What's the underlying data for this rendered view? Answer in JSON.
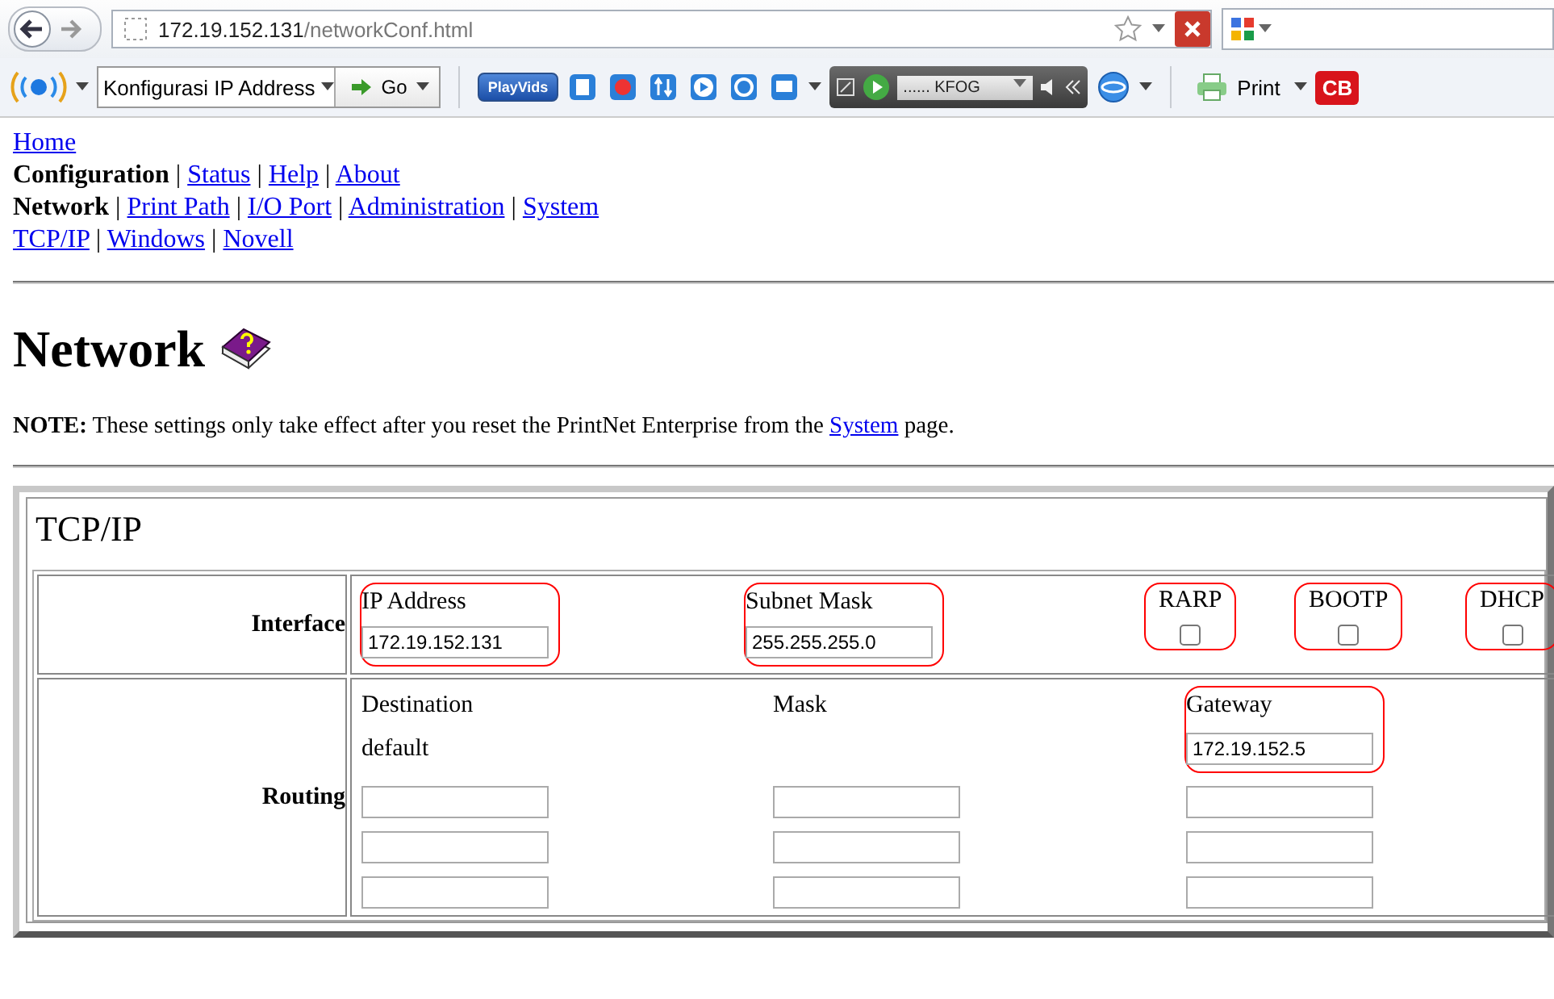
{
  "browser": {
    "address": {
      "host": "172.19.152.131",
      "path": "/networkConf.html"
    },
    "toolbar": {
      "dropdown_value": "Konfigurasi IP Address",
      "go": "Go",
      "playvids": "PlayVids",
      "station": "...... KFOG",
      "print": "Print",
      "cb": "CB"
    }
  },
  "nav": [
    {
      "items": [
        {
          "label": "Home",
          "current": false
        }
      ]
    },
    {
      "separators": [
        "|",
        "|",
        "|"
      ],
      "items": [
        {
          "label": "Configuration",
          "current": true
        },
        {
          "label": "Status",
          "current": false
        },
        {
          "label": "Help",
          "current": false
        },
        {
          "label": "About",
          "current": false
        }
      ]
    },
    {
      "separators": [
        "|",
        "|",
        "|",
        "|"
      ],
      "items": [
        {
          "label": "Network",
          "current": true
        },
        {
          "label": "Print Path",
          "current": false
        },
        {
          "label": "I/O Port",
          "current": false
        },
        {
          "label": "Administration",
          "current": false
        },
        {
          "label": "System",
          "current": false
        }
      ]
    },
    {
      "separators": [
        "|",
        "|"
      ],
      "items": [
        {
          "label": "TCP/IP",
          "current": false
        },
        {
          "label": "Windows",
          "current": false
        },
        {
          "label": "Novell",
          "current": false
        }
      ]
    }
  ],
  "heading": "Network",
  "note": {
    "text": "**NOTE:** These settings only take effect after you reset the PrintNet Enterprise from the",
    "link": "System",
    "after": "page."
  },
  "panel": {
    "title": "TCP/IP",
    "interface": {
      "label": "Interface",
      "fields": [
        {
          "kind": "text",
          "label": "IP Address",
          "value": "172.19.152.131",
          "highlighted": true
        },
        {
          "kind": "text",
          "label": "Subnet Mask",
          "value": "255.255.255.0",
          "highlighted": true
        },
        {
          "kind": "checkbox",
          "label": "RARP",
          "checked": false,
          "highlighted": true
        },
        {
          "kind": "checkbox",
          "label": "BOOTP",
          "checked": false,
          "highlighted": true
        },
        {
          "kind": "checkbox",
          "label": "DHCP",
          "checked": false,
          "highlighted": true
        }
      ]
    },
    "routing": {
      "label": "Routing",
      "columns": [
        {
          "label": "Destination",
          "highlighted": false,
          "cells": [
            {
              "kind": "text",
              "value": "default"
            },
            {
              "kind": "input"
            },
            {
              "kind": "input"
            },
            {
              "kind": "input"
            }
          ]
        },
        {
          "label": "Mask",
          "highlighted": false,
          "cells": [
            {
              "kind": "blank"
            },
            {
              "kind": "input"
            },
            {
              "kind": "input"
            },
            {
              "kind": "input"
            }
          ]
        },
        {
          "label": "Gateway",
          "highlighted": true,
          "cells": [
            {
              "kind": "input",
              "value": "172.19.152.5"
            },
            {
              "kind": "input"
            },
            {
              "kind": "input"
            },
            {
              "kind": "input"
            }
          ]
        }
      ]
    }
  }
}
